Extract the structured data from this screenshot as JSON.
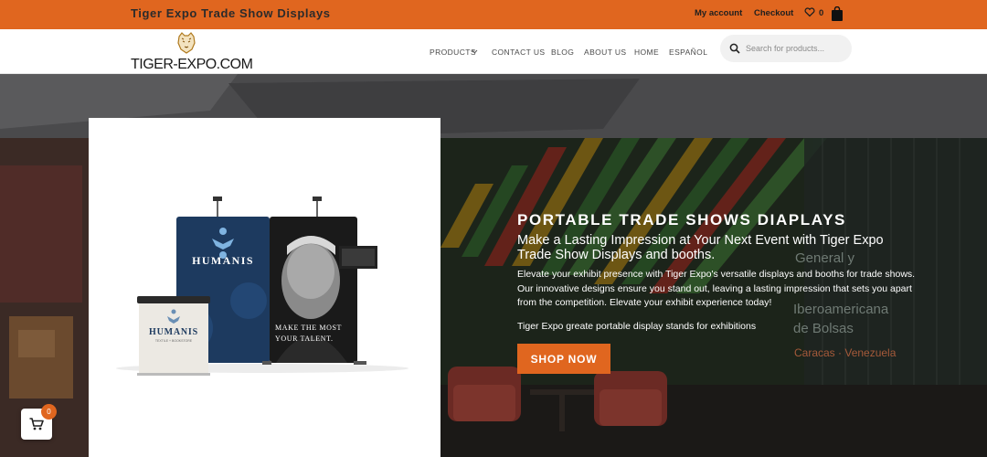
{
  "topbar": {
    "site_title": "Tiger Expo Trade Show Displays",
    "my_account": "My account",
    "checkout": "Checkout",
    "wishlist_count": "0",
    "icons": [
      "heart-icon",
      "shopping-bag-icon"
    ]
  },
  "nav": {
    "logo_text": "TIGER-EXPO.COM",
    "items": [
      "PRODUCTS",
      "CONTACT US",
      "BLOG",
      "ABOUT US",
      "HOME",
      "ESPAÑOL"
    ],
    "search_placeholder": "Search for products..."
  },
  "hero": {
    "title": "PORTABLE TRADE SHOWS DIAPLAYS",
    "subtitle": "Make a Lasting Impression at Your Next Event with Tiger Expo Trade Show Displays and booths.",
    "body": "Elevate your exhibit presence with Tiger Expo's versatile displays and booths for trade shows. Our innovative designs ensure you stand out, leaving a lasting impression that sets you apart from the competition. Elevate your exhibit experience today!",
    "body2": "Tiger Expo greate portable display stands for exhibitions",
    "cta": "SHOP NOW",
    "background_sign": [
      "General y",
      "Iberoamericana",
      "de Bolsas",
      "Caracas · Venezuela"
    ]
  },
  "product_image": {
    "brand": "HUMANIS",
    "counter_brand": "HUMANIS",
    "counter_tagline": "TEXTILE + BOOKSTORE",
    "slogan_line1": "MAKE THE MOST",
    "slogan_line2": "YOUR TALENT."
  },
  "floating_cart": {
    "count": "0"
  },
  "colors": {
    "accent": "#e0661f",
    "topbar_text": "#2b2b2b",
    "navy": "#1d3a5f"
  }
}
